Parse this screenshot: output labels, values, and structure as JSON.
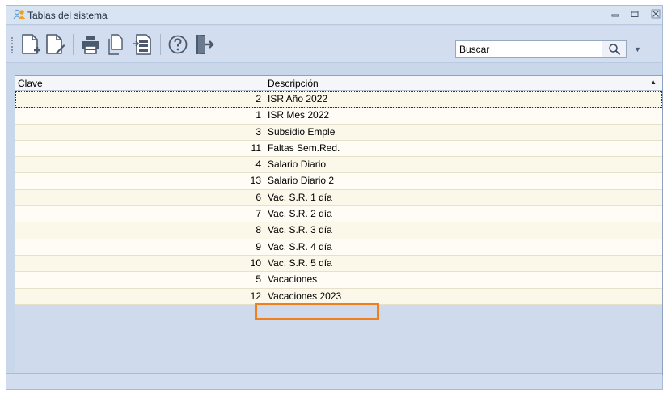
{
  "window": {
    "title": "Tablas del sistema",
    "accent": "#f07f1e"
  },
  "toolbar": {
    "buttons": [
      {
        "icon": "new-document-icon"
      },
      {
        "icon": "edit-document-icon"
      },
      {
        "icon": "print-icon"
      },
      {
        "icon": "copy-icon"
      },
      {
        "icon": "import-icon"
      },
      {
        "icon": "help-icon"
      },
      {
        "icon": "exit-icon"
      }
    ],
    "search": {
      "placeholder": "Buscar",
      "value": ""
    }
  },
  "grid": {
    "columns": {
      "clave": "Clave",
      "descripcion": "Descripción"
    },
    "rows": [
      {
        "clave": "2",
        "descripcion": "ISR Año 2022"
      },
      {
        "clave": "1",
        "descripcion": "ISR Mes 2022"
      },
      {
        "clave": "3",
        "descripcion": "Subsidio Emple"
      },
      {
        "clave": "11",
        "descripcion": "Faltas Sem.Red."
      },
      {
        "clave": "4",
        "descripcion": "Salario Diario"
      },
      {
        "clave": "13",
        "descripcion": "Salario Diario 2"
      },
      {
        "clave": "6",
        "descripcion": "Vac. S.R. 1 día"
      },
      {
        "clave": "7",
        "descripcion": "Vac. S.R. 2 día"
      },
      {
        "clave": "8",
        "descripcion": "Vac. S.R. 3 día"
      },
      {
        "clave": "9",
        "descripcion": "Vac. S.R. 4 día"
      },
      {
        "clave": "10",
        "descripcion": "Vac. S.R. 5 día"
      },
      {
        "clave": "5",
        "descripcion": "Vacaciones"
      },
      {
        "clave": "12",
        "descripcion": "Vacaciones 2023"
      }
    ]
  }
}
